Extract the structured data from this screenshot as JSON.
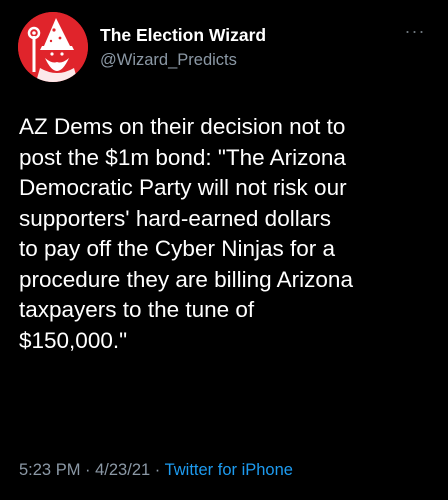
{
  "tweet": {
    "display_name": "The Election Wizard",
    "handle": "@Wizard_Predicts",
    "more_label": "···",
    "body_lines": [
      "AZ Dems on their decision not to",
      "post the $1m bond: \"The Arizona",
      "Democratic Party will not risk our",
      "supporters' hard-earned dollars",
      "to pay off the Cyber Ninjas for a",
      "procedure they are billing Arizona",
      "taxpayers to the tune of",
      "$150,000.\""
    ],
    "time": "5:23 PM",
    "separator": " · ",
    "date": "4/23/21",
    "source": "Twitter for iPhone"
  },
  "colors": {
    "background": "#000000",
    "text": "#ffffff",
    "secondary_text": "#8b98a5",
    "link": "#1d9bf0",
    "avatar_background": "#e0242b"
  },
  "icons": {
    "avatar": "wizard-avatar-icon",
    "more": "more-options-icon"
  }
}
